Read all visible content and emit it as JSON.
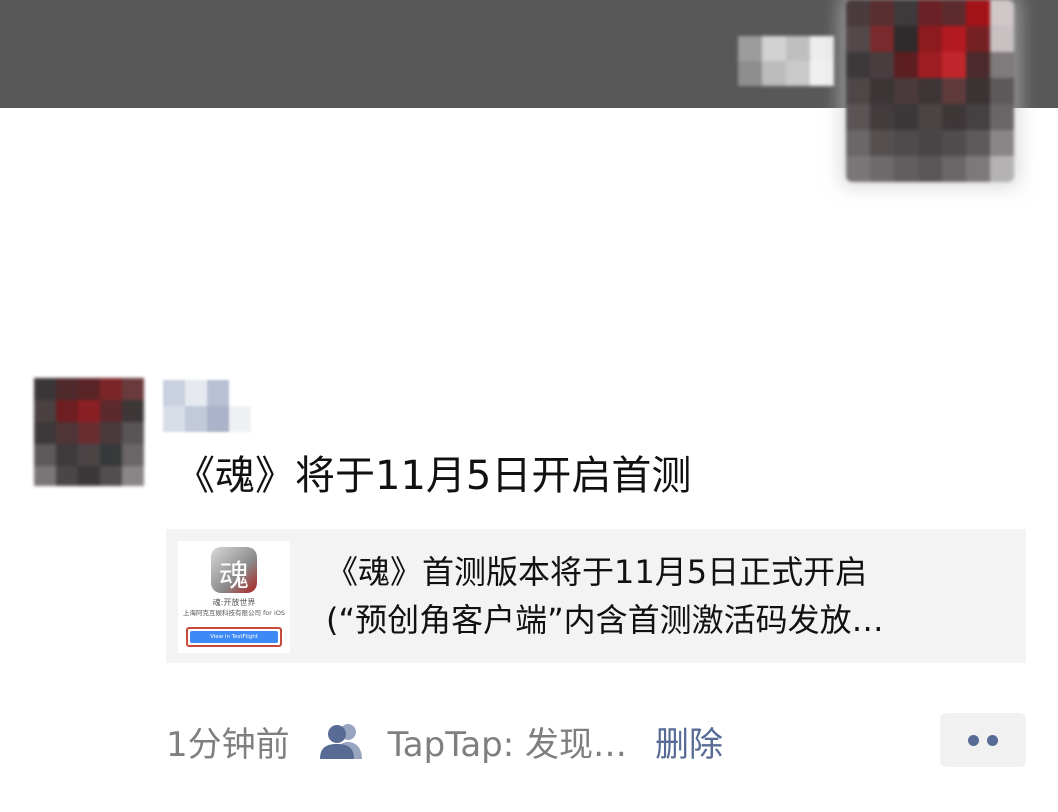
{
  "colors": {
    "cover_background": "#585858",
    "link_blue": "#576b95",
    "card_background": "#f3f3f3",
    "meta_gray": "#7f7f7f"
  },
  "cover_mosaic_cells": [
    "#9c9c9c",
    "#d2d2d2",
    "#bfbfbf",
    "#ededed",
    "#8e8e8e",
    "#bcbcbc",
    "#cacaca",
    "#f1f1f1"
  ],
  "own_avatar_cells": [
    "#4a3b3d",
    "#5a2f31",
    "#3e3a3b",
    "#6b2226",
    "#5d2b2e",
    "#a31419",
    "#d0c7c8",
    "#53494a",
    "#7a2a2c",
    "#2f2a2b",
    "#8d1a1e",
    "#b31a20",
    "#752023",
    "#c8c0c1",
    "#3d393a",
    "#4a3d3f",
    "#5c1e21",
    "#9e1d22",
    "#c0272d",
    "#4a2a2c",
    "#7f7a7b",
    "#4d4748",
    "#3b3536",
    "#4b3a3c",
    "#3e3536",
    "#5f3b3d",
    "#3a3334",
    "#5d5859",
    "#5a5455",
    "#423c3d",
    "#3c3738",
    "#4a4445",
    "#3d3738",
    "#454041",
    "#6a6566",
    "#6b6667",
    "#55504f",
    "#4f4a4b",
    "#4a4546",
    "#514c4d",
    "#5e5a5b",
    "#8a8687",
    "#7b7778",
    "#6e6a6b",
    "#625e5f",
    "#5a5657",
    "#6a6667",
    "#7d797a",
    "#b5b2b3"
  ],
  "post_avatar_cells": [
    "#3a3536",
    "#4e2a2c",
    "#5a2426",
    "#7b2528",
    "#6a3a3c",
    "#4a4041",
    "#6e1d21",
    "#8a1f24",
    "#5c2a2c",
    "#3e3738",
    "#3d3839",
    "#4f3537",
    "#6a2e31",
    "#4a3a3b",
    "#595455",
    "#5e595a",
    "#3f3a3b",
    "#4b4546",
    "#37393a",
    "#6a6566",
    "#7a7576",
    "#4a4546",
    "#3c3738",
    "#524d4e",
    "#8a8687"
  ],
  "nick_mosaic_cells": [
    "#c9d0e0",
    "#e6e9f0",
    "#b8c0d4",
    "#ffffff",
    "#d8dde8",
    "#c2c9da",
    "#aab3c9",
    "#eef0f4"
  ],
  "post": {
    "text": "《魂》将于11月5日开启首测"
  },
  "link_card": {
    "line1": "《魂》首测版本将于11月5日正式开启",
    "line2": "(“预创角客户端”内含首测激活码发放…",
    "thumbnail": {
      "app_glyph": "魂",
      "title": "魂:开放世界",
      "company": "上海阿克互娱科技有限公司 for iOS",
      "button": "View in TestFlight"
    }
  },
  "meta": {
    "time": "1分钟前",
    "source_icon": "people-icon",
    "source": "TapTap: 发现…",
    "delete_label": "删除",
    "more_icon": "more-dots-icon"
  }
}
